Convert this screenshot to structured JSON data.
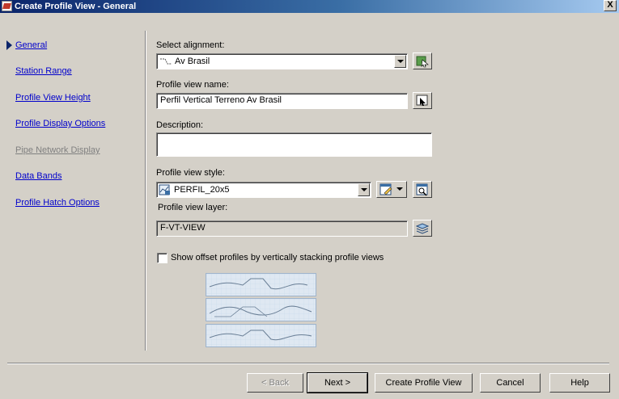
{
  "window": {
    "title": "Create Profile View - General",
    "close_label": "X"
  },
  "nav": {
    "items": [
      {
        "label": "General",
        "active": true,
        "enabled": true
      },
      {
        "label": "Station Range",
        "active": false,
        "enabled": true
      },
      {
        "label": "Profile View Height",
        "active": false,
        "enabled": true
      },
      {
        "label": "Profile Display Options",
        "active": false,
        "enabled": true
      },
      {
        "label": "Pipe Network Display",
        "active": false,
        "enabled": false
      },
      {
        "label": "Data Bands",
        "active": false,
        "enabled": true
      },
      {
        "label": "Profile Hatch Options",
        "active": false,
        "enabled": true
      }
    ]
  },
  "form": {
    "alignment_label": "Select alignment:",
    "alignment_value": "Av Brasil",
    "view_name_label": "Profile view name:",
    "view_name_value": "Perfil Vertical Terreno Av Brasil",
    "description_label": "Description:",
    "description_value": "",
    "style_label": "Profile view style:",
    "style_value": "PERFIL_20x5",
    "layer_label": "Profile view layer:",
    "layer_value": "F-VT-VIEW",
    "offset_checkbox_label": "Show offset profiles by vertically stacking profile views",
    "offset_checked": false
  },
  "buttons": {
    "back": "< Back",
    "next": "Next >",
    "create": "Create Profile View",
    "cancel": "Cancel",
    "help": "Help"
  },
  "icons": {
    "alignment_pick": "pick-from-drawing-icon",
    "name_edit": "edit-name-icon",
    "style_edit": "edit-style-icon",
    "style_preview": "preview-icon",
    "layer": "layers-icon"
  },
  "colors": {
    "titlebar_start": "#0a246a",
    "link": "#0000cc",
    "disabled": "#808080"
  }
}
